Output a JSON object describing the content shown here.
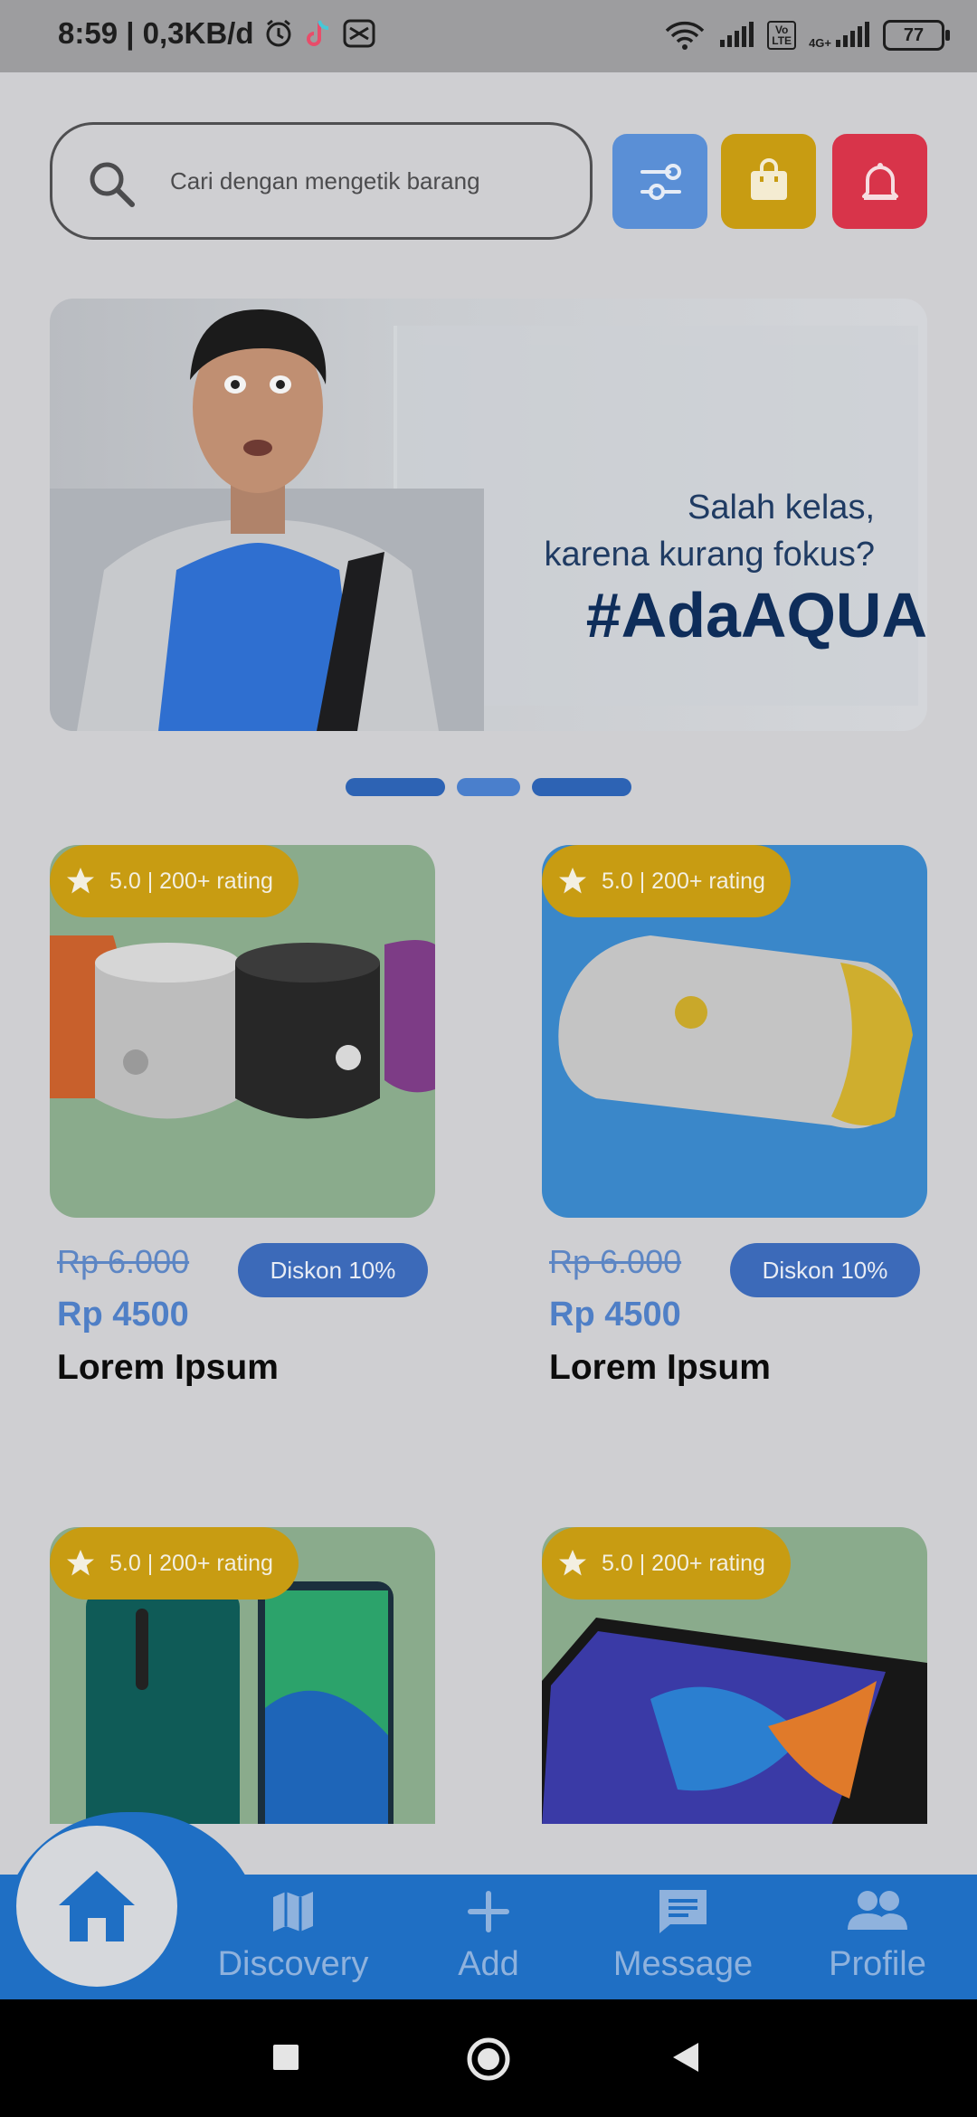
{
  "status_bar": {
    "time_and_speed": "8:59 | 0,3KB/d",
    "volte": "Vo\nLTE",
    "net_4g": "4G+",
    "battery": "77"
  },
  "search": {
    "placeholder": "Cari dengan mengetik barang"
  },
  "header_buttons": {
    "filter": "sliders-icon",
    "bag": "shopping-bag-icon",
    "bell": "bell-icon"
  },
  "banner": {
    "line1": "Salah kelas,",
    "line2": "karena kurang fokus?",
    "hashtag": "#AdaAQUA"
  },
  "carousel": {
    "count": 3,
    "active_index": 1
  },
  "products": [
    {
      "rating": "5.0 | 200+ rating",
      "old_price": "Rp 6.000",
      "discount": "Diskon 10%",
      "price": "Rp 4500",
      "name": "Lorem Ipsum"
    },
    {
      "rating": "5.0 | 200+ rating",
      "old_price": "Rp 6.000",
      "discount": "Diskon 10%",
      "price": "Rp 4500",
      "name": "Lorem Ipsum"
    },
    {
      "rating": "5.0 | 200+ rating"
    },
    {
      "rating": "5.0 | 200+ rating"
    }
  ],
  "bottom_nav": {
    "items": [
      {
        "label": "Discovery",
        "icon": "map-icon"
      },
      {
        "label": "Add",
        "icon": "plus-icon"
      },
      {
        "label": "Message",
        "icon": "message-icon"
      },
      {
        "label": "Profile",
        "icon": "people-icon"
      }
    ],
    "home_icon": "home-icon"
  },
  "colors": {
    "primary": "#1f6fc4",
    "rating_badge": "#c89c12",
    "bell_button": "#d8344a",
    "filter_button": "#5a8fd6"
  }
}
